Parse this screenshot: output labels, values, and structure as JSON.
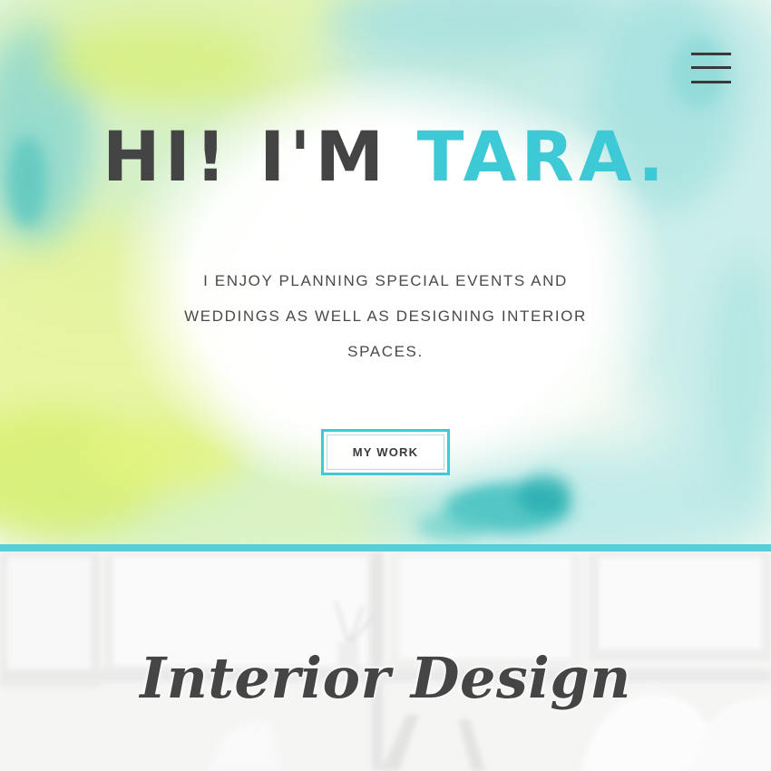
{
  "colors": {
    "accent": "#3ec9d6",
    "heading": "#444444",
    "divider": "#57cfd9",
    "button_border": "#46c8d4"
  },
  "header": {
    "menu_icon": "hamburger-menu-icon"
  },
  "hero": {
    "title_main": "HI! I'M ",
    "title_accent": "TARA.",
    "tagline": "I ENJOY PLANNING SPECIAL EVENTS AND WEDDINGS AS WELL AS DESIGNING INTERIOR SPACES.",
    "button_label": "MY WORK"
  },
  "sections": {
    "interior_title": "Interior Design"
  }
}
